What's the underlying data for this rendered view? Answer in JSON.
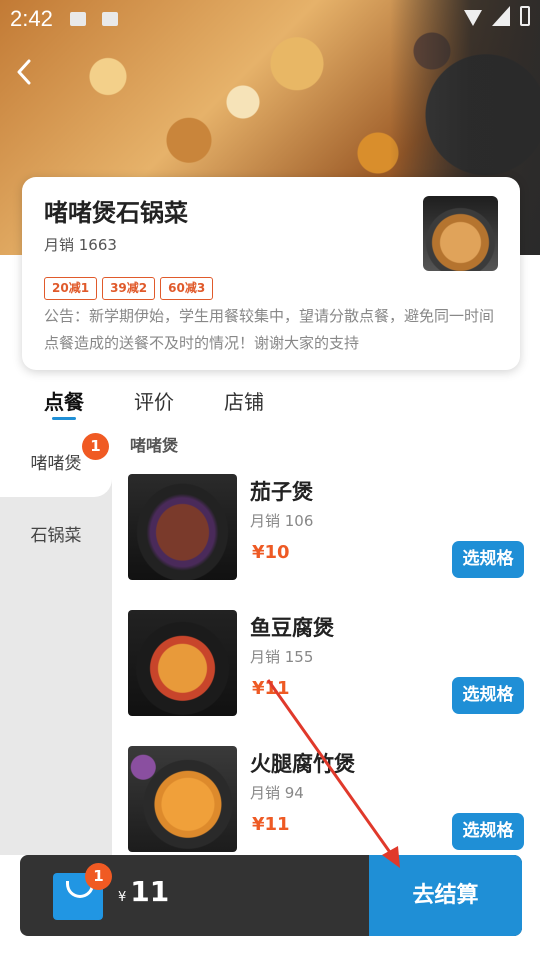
{
  "status_bar": {
    "time": "2:42"
  },
  "shop": {
    "name": "啫啫煲石锅菜",
    "monthly_sales": "月销 1663",
    "coupons": [
      "20减1",
      "39减2",
      "60减3"
    ],
    "notice": "公告：新学期伊始，学生用餐较集中，望请分散点餐，避免同一时间点餐造成的送餐不及时的情况！谢谢大家的支持"
  },
  "tabs": [
    {
      "label": "点餐",
      "active": true
    },
    {
      "label": "评价",
      "active": false
    },
    {
      "label": "店铺",
      "active": false
    }
  ],
  "categories": [
    {
      "label": "啫啫煲",
      "badge": "1",
      "active": true
    },
    {
      "label": "石锅菜",
      "active": false
    }
  ],
  "menu": {
    "section_title": "啫啫煲",
    "dishes": [
      {
        "name": "茄子煲",
        "sales": "月销 106",
        "price": "¥10",
        "button": "选规格"
      },
      {
        "name": "鱼豆腐煲",
        "sales": "月销 155",
        "price": "¥11",
        "button": "选规格"
      },
      {
        "name": "火腿腐竹煲",
        "sales": "月销 94",
        "price": "¥11",
        "button": "选规格"
      }
    ]
  },
  "cart": {
    "badge": "1",
    "currency": "¥",
    "amount": "11",
    "checkout_label": "去结算"
  },
  "colors": {
    "accent": "#1f8fd6",
    "price": "#ee5a24",
    "badge": "#f05a23",
    "annotation_arrow": "#e0392b"
  },
  "icons": [
    "back-arrow-icon",
    "shopping-bag-icon",
    "wifi-icon",
    "signal-icon",
    "battery-icon"
  ]
}
